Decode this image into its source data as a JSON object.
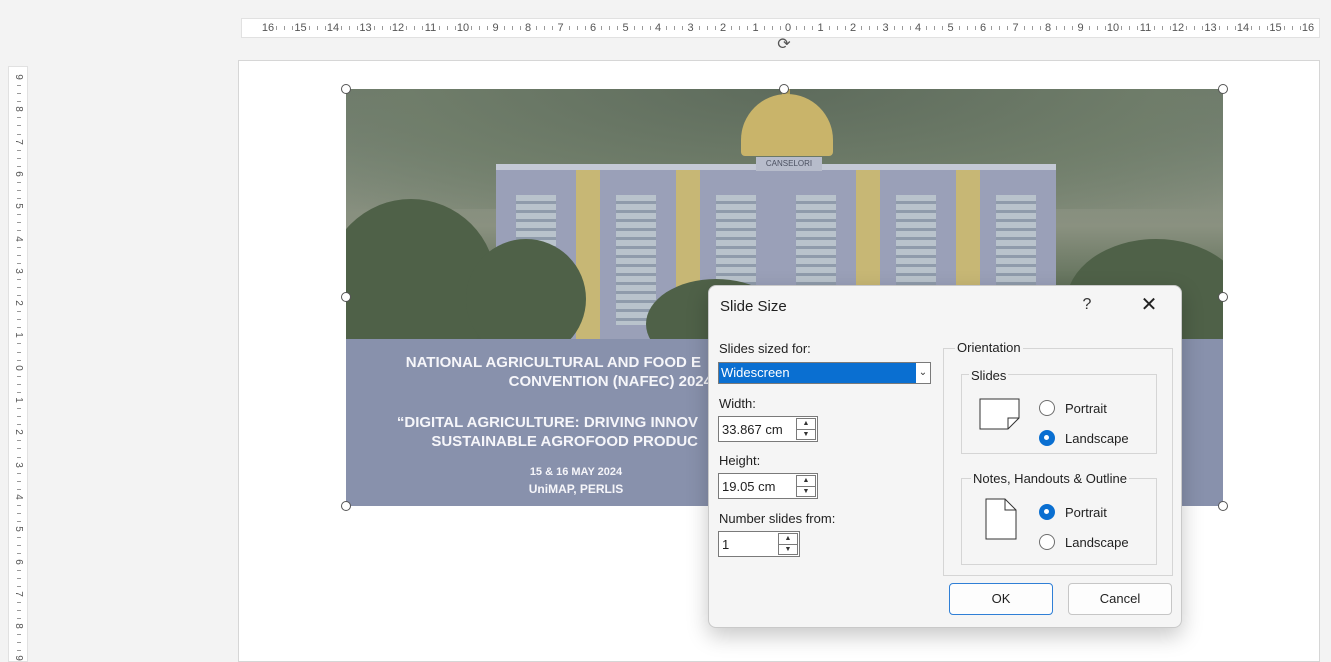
{
  "ruler": {
    "horizontal": [
      "16",
      "15",
      "14",
      "13",
      "12",
      "11",
      "10",
      "9",
      "8",
      "7",
      "6",
      "5",
      "4",
      "3",
      "2",
      "1",
      "0",
      "1",
      "2",
      "3",
      "4",
      "5",
      "6",
      "7",
      "8",
      "9",
      "10",
      "11",
      "12",
      "13",
      "14",
      "15",
      "16"
    ],
    "vertical": [
      "9",
      "8",
      "7",
      "6",
      "5",
      "4",
      "3",
      "2",
      "1",
      "0",
      "1",
      "2",
      "3",
      "4",
      "5",
      "6",
      "7",
      "8",
      "9"
    ]
  },
  "slide": {
    "building_sign": "CANSELORI",
    "title_line1": "NATIONAL AGRICULTURAL AND FOOD E",
    "title_line2": "CONVENTION (NAFEC) 2024",
    "theme_line1": "“DIGITAL AGRICULTURE: DRIVING INNOV",
    "theme_line2": "SUSTAINABLE AGROFOOD PRODUC",
    "date": "15 & 16 MAY 2024",
    "venue": "UniMAP, PERLIS"
  },
  "dialog": {
    "title": "Slide Size",
    "help": "?",
    "close": "✕",
    "sized_for_label": "Slides sized for:",
    "sized_for_value": "Widescreen",
    "width_label": "Width:",
    "width_value": "33.867 cm",
    "height_label": "Height:",
    "height_value": "19.05 cm",
    "number_from_label": "Number slides from:",
    "number_from_value": "1",
    "orientation_label": "Orientation",
    "slides_group_label": "Slides",
    "slides_portrait": "Portrait",
    "slides_landscape": "Landscape",
    "notes_group_label": "Notes, Handouts & Outline",
    "notes_portrait": "Portrait",
    "notes_landscape": "Landscape",
    "ok": "OK",
    "cancel": "Cancel",
    "selected_slides_orientation": "Landscape",
    "selected_notes_orientation": "Portrait"
  },
  "colors": {
    "accent": "#0a6fd1",
    "band": "#8891ac"
  },
  "icons": {
    "rotate_handle": "rotate-icon",
    "dropdown": "chevron-down-icon",
    "spin": "spin-arrows-icon",
    "slides_orientation_icon": "landscape-page-icon",
    "notes_orientation_icon": "portrait-page-icon"
  }
}
